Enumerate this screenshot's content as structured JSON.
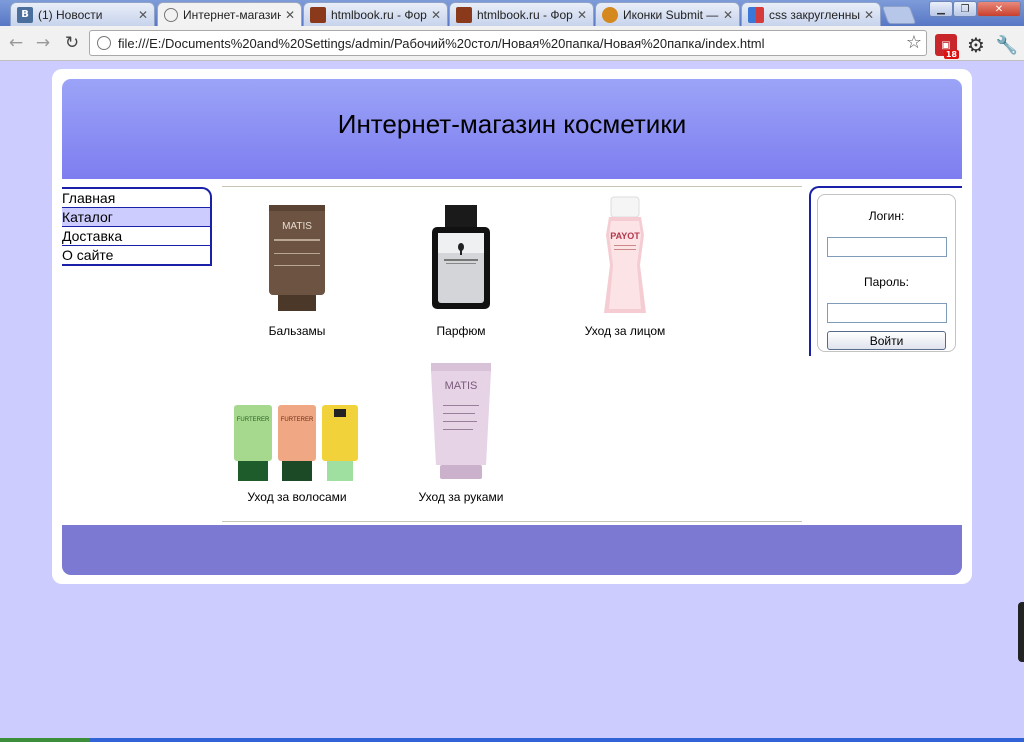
{
  "browser": {
    "tabs": [
      {
        "title": "(1) Новости",
        "favicon": "В",
        "favicon_color": "#4a6f9c"
      },
      {
        "title": "Интернет-магазин",
        "favicon": "",
        "favicon_color": "#888888"
      },
      {
        "title": "htmlbook.ru - Форма",
        "favicon": "",
        "favicon_color": "#8a3a1a"
      },
      {
        "title": "htmlbook.ru - Форма",
        "favicon": "",
        "favicon_color": "#8a3a1a"
      },
      {
        "title": "Иконки Submit — Cr",
        "favicon": "",
        "favicon_color": "#d4881e"
      },
      {
        "title": "css закругленный",
        "favicon": "",
        "favicon_color": "#3b77d6"
      }
    ],
    "active_tab_index": 1,
    "url": "file:///E:/Documents%20and%20Settings/admin/Рабочий%20стол/Новая%20папка/Новая%20папка/index.html",
    "extension_badge": "18"
  },
  "site": {
    "title": "Интернет-магазин косметики",
    "menu": [
      {
        "label": "Главная",
        "selected": false
      },
      {
        "label": "Каталог",
        "selected": true
      },
      {
        "label": "Доставка",
        "selected": false
      },
      {
        "label": "О сайте",
        "selected": false
      }
    ],
    "products": [
      {
        "caption": "Бальзамы",
        "brand": "MATIS",
        "icon": "balm-tube-image"
      },
      {
        "caption": "Парфюм",
        "brand": "",
        "icon": "perfume-bottle-image"
      },
      {
        "caption": "Уход за лицом",
        "brand": "PAYOT",
        "icon": "face-care-bottle-image"
      },
      {
        "caption": "Уход за волосами",
        "brand": "FURTERER",
        "icon": "hair-care-tubes-image"
      },
      {
        "caption": "Уход за руками",
        "brand": "MATIS",
        "icon": "hand-cream-tube-image"
      }
    ],
    "login": {
      "login_label": "Логин:",
      "login_value": "",
      "password_label": "Пароль:",
      "password_value": "",
      "submit_label": "Войти"
    }
  },
  "colors": {
    "page_background": "#ccccff",
    "header_gradient_top": "#9ba4f7",
    "header_gradient_bottom": "#7e7df0",
    "footer": "#7b79d1",
    "menu_border": "#1a21a8",
    "menu_selected": "#ccccff"
  }
}
